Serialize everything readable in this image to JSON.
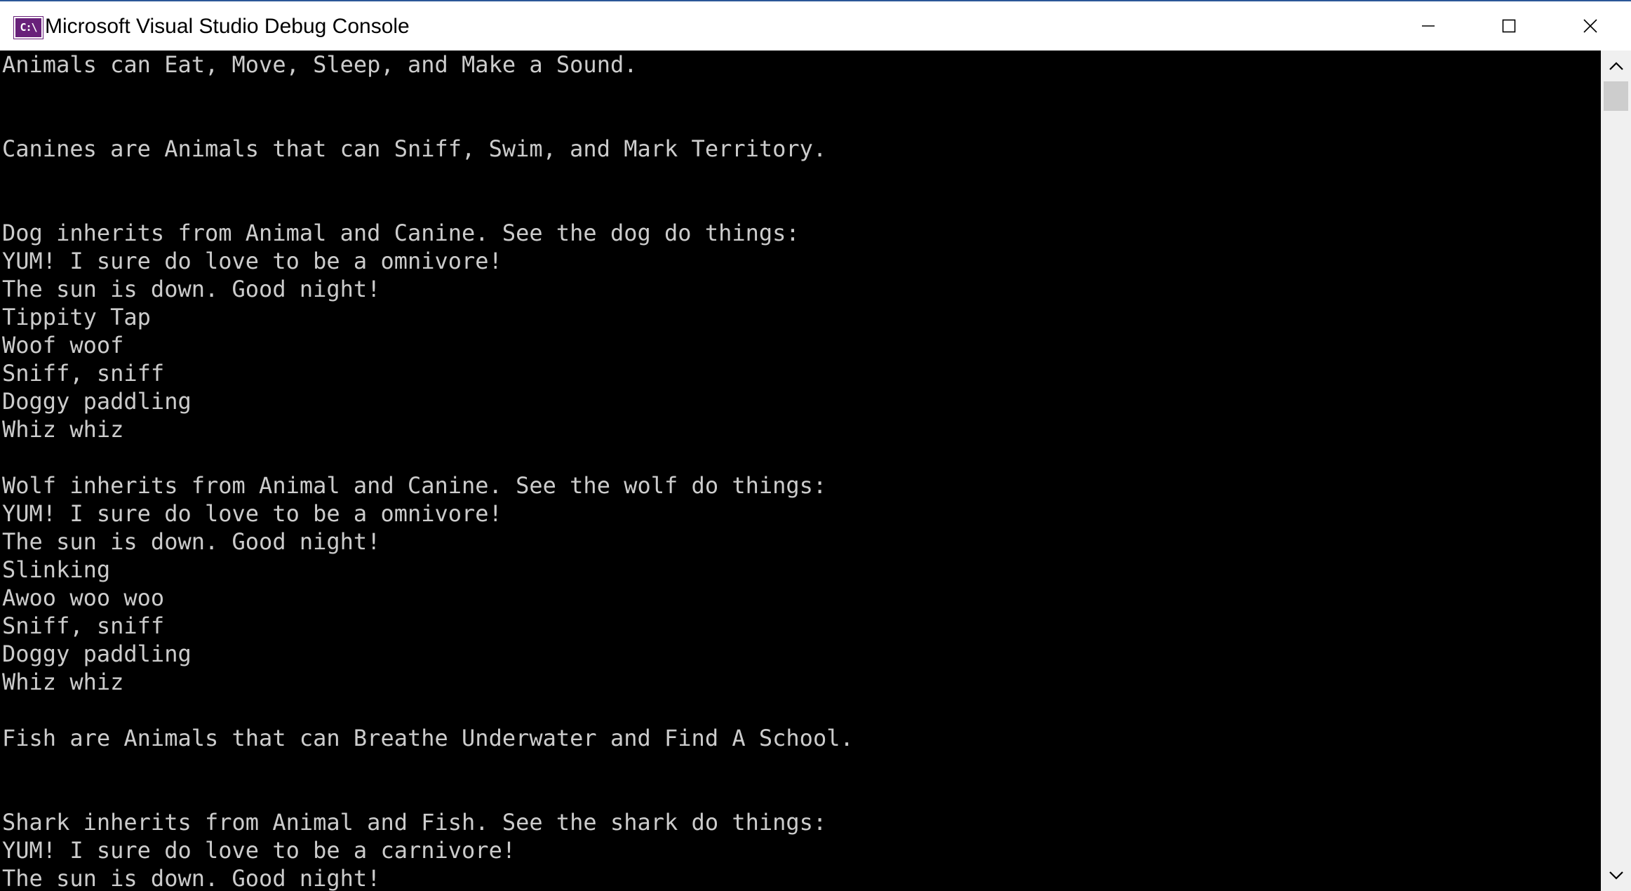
{
  "window": {
    "title": "Microsoft Visual Studio Debug Console",
    "icon_text": "C:\\"
  },
  "caption_buttons": {
    "minimize": "minimize-icon",
    "maximize": "maximize-icon",
    "close": "close-icon"
  },
  "console": {
    "lines": [
      "Animals can Eat, Move, Sleep, and Make a Sound.",
      "",
      "",
      "Canines are Animals that can Sniff, Swim, and Mark Territory.",
      "",
      "",
      "Dog inherits from Animal and Canine. See the dog do things:",
      "YUM! I sure do love to be a omnivore!",
      "The sun is down. Good night!",
      "Tippity Tap",
      "Woof woof",
      "Sniff, sniff",
      "Doggy paddling",
      "Whiz whiz",
      "",
      "Wolf inherits from Animal and Canine. See the wolf do things:",
      "YUM! I sure do love to be a omnivore!",
      "The sun is down. Good night!",
      "Slinking",
      "Awoo woo woo",
      "Sniff, sniff",
      "Doggy paddling",
      "Whiz whiz",
      "",
      "Fish are Animals that can Breathe Underwater and Find A School.",
      "",
      "",
      "Shark inherits from Animal and Fish. See the shark do things:",
      "YUM! I sure do love to be a carnivore!",
      "The sun is down. Good night!"
    ]
  },
  "scrollbar": {
    "up_icon": "scroll-up-arrow-icon",
    "down_icon": "scroll-down-arrow-icon"
  },
  "colors": {
    "console_background": "#000000",
    "console_text": "#cccccc",
    "icon_background": "#68217a"
  }
}
